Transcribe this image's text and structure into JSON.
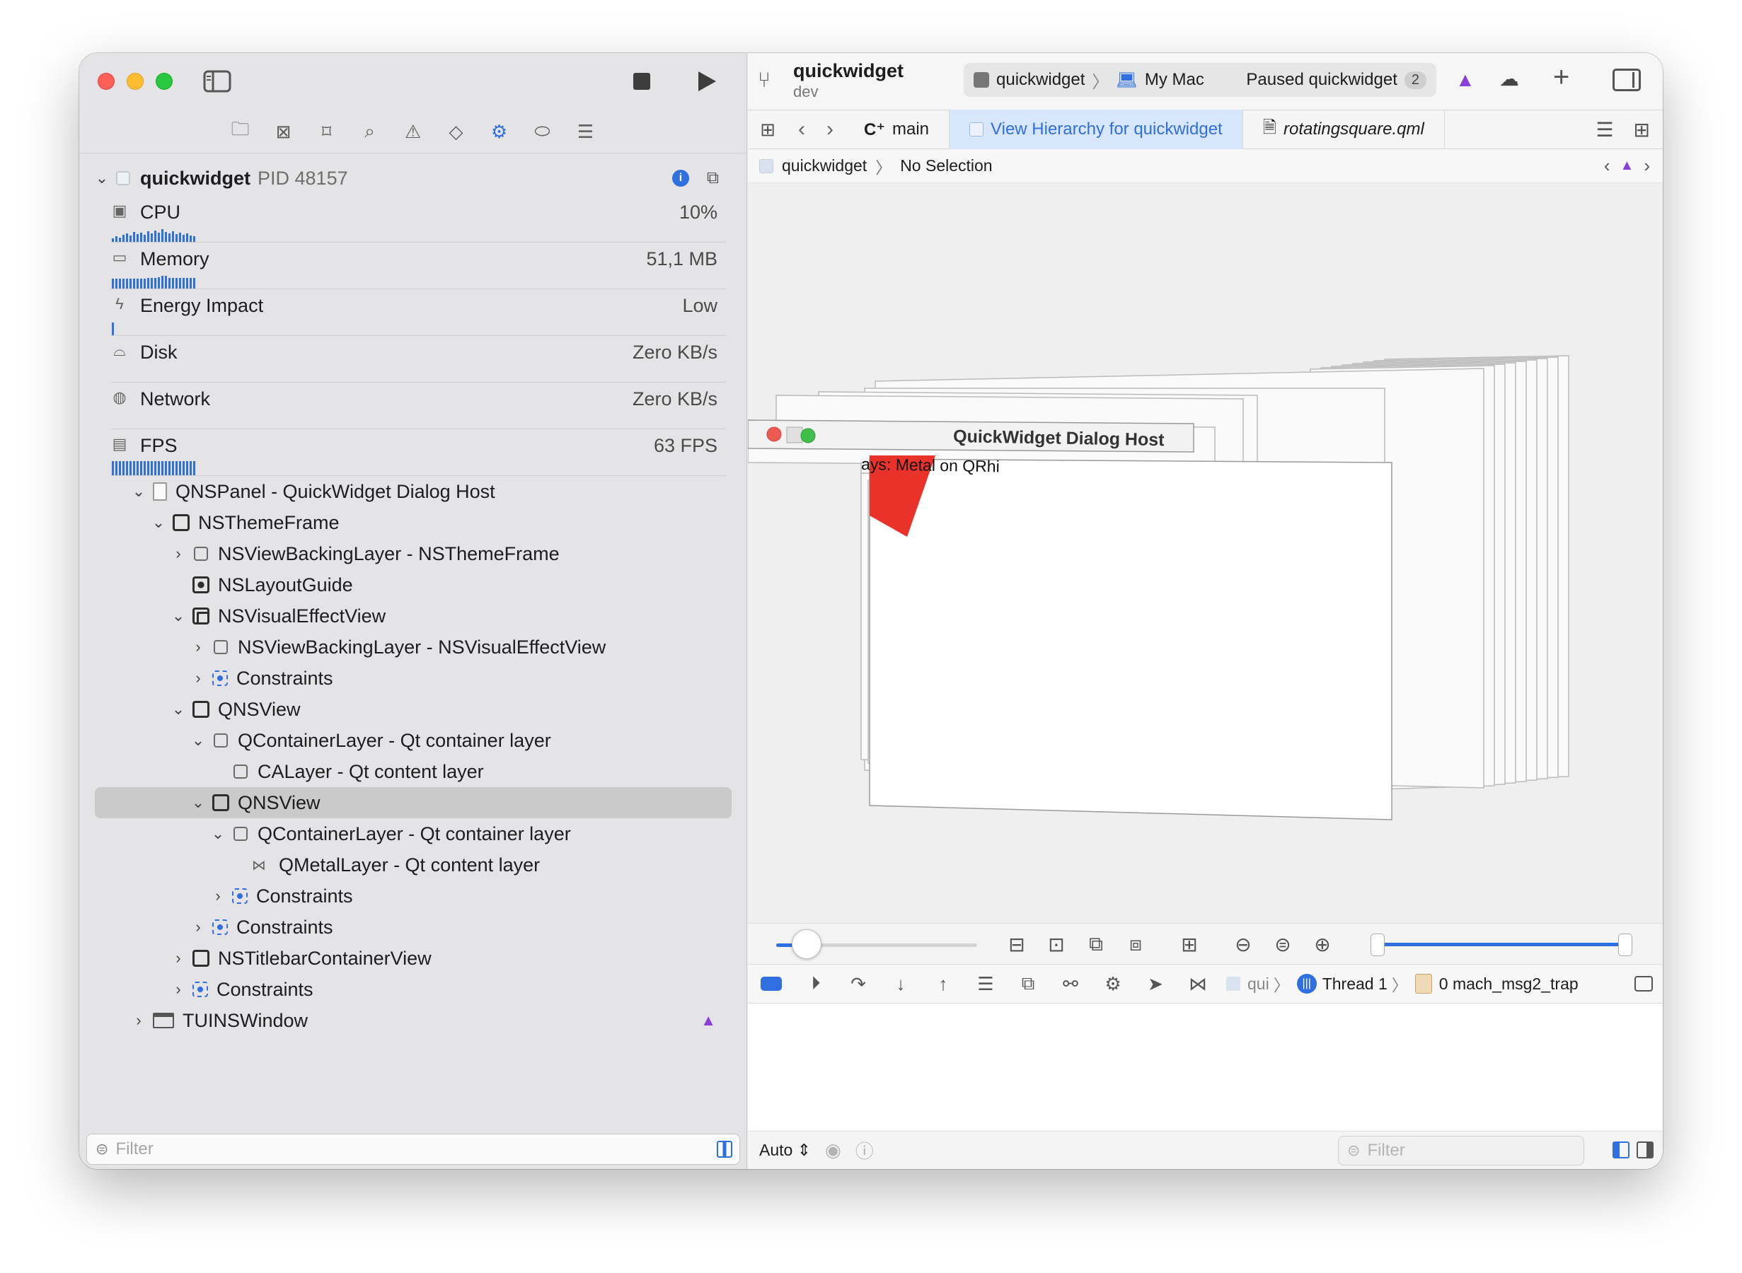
{
  "left_pane": {
    "process": {
      "name": "quickwidget",
      "pid": "PID 48157"
    },
    "gauges": [
      {
        "label": "CPU",
        "value": "10%",
        "icon": "cpu-icon"
      },
      {
        "label": "Memory",
        "value": "51,1 MB",
        "icon": "memory-icon"
      },
      {
        "label": "Energy Impact",
        "value": "Low",
        "icon": "bolt-icon"
      },
      {
        "label": "Disk",
        "value": "Zero KB/s",
        "icon": "disk-icon"
      },
      {
        "label": "Network",
        "value": "Zero KB/s",
        "icon": "globe-icon"
      },
      {
        "label": "FPS",
        "value": "63 FPS",
        "icon": "film-icon"
      }
    ],
    "hierarchy": [
      "QNSPanel - QuickWidget Dialog Host",
      "NSThemeFrame",
      "NSViewBackingLayer - NSThemeFrame",
      "NSLayoutGuide",
      "NSVisualEffectView",
      "NSViewBackingLayer - NSVisualEffectView",
      "Constraints",
      "QNSView",
      "QContainerLayer - Qt container layer",
      "CALayer - Qt content layer",
      "QNSView",
      "QContainerLayer - Qt container layer",
      "QMetalLayer - Qt content layer",
      "Constraints",
      "Constraints",
      "NSTitlebarContainerView",
      "Constraints",
      "TUINSWindow"
    ],
    "filter_placeholder": "Filter"
  },
  "toolbar": {
    "project": "quickwidget",
    "branch": "dev",
    "scheme": "quickwidget",
    "destination": "My Mac",
    "status": "Paused quickwidget",
    "status_count": "2"
  },
  "tabs": [
    {
      "label": "main",
      "prefix": "C⁺"
    },
    {
      "label": "View Hierarchy for quickwidget"
    },
    {
      "label": "rotatingsquare.qml"
    }
  ],
  "jumpbar": {
    "item": "quickwidget",
    "selection": "No Selection"
  },
  "canvas": {
    "window_title": "QuickWidget Dialog Host",
    "content_text": "ays: Metal on QRhi"
  },
  "zoom": {
    "spacing_fraction": 0.15
  },
  "debugbar": {
    "process_short": "qui",
    "thread": "Thread 1",
    "frame": "0 mach_msg2_trap"
  },
  "bottombar": {
    "mode": "Auto",
    "filter_placeholder": "Filter"
  },
  "colors": {
    "accent": "#2f6fe0",
    "warning": "#8b3fd9",
    "red_square": "#e8322a"
  }
}
